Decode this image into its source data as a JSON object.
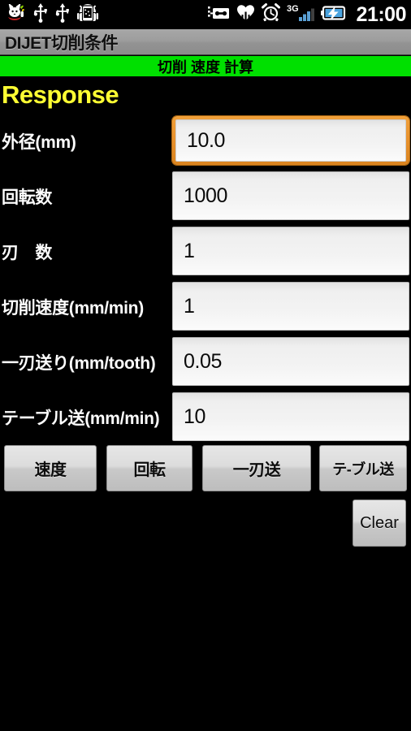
{
  "statusbar": {
    "clock": "21:00",
    "left_icons": [
      {
        "name": "cat-mascot-icon"
      },
      {
        "name": "usb-icon"
      },
      {
        "name": "usb-icon"
      },
      {
        "name": "android-debug-icon"
      }
    ],
    "right_icons": [
      {
        "name": "notification-tag-icon"
      },
      {
        "name": "heart-icon"
      },
      {
        "name": "alarm-clock-icon"
      },
      {
        "name": "signal-3g-icon",
        "label": "3G"
      },
      {
        "name": "battery-charging-icon"
      }
    ]
  },
  "titlebar": {
    "app_title": "DIJET切削条件"
  },
  "banner": {
    "text": "切削 速度 計算",
    "background": "#00e000"
  },
  "main": {
    "heading": "Response",
    "heading_color": "#ffff33",
    "fields": [
      {
        "label": "外径(mm)",
        "value": "10.0",
        "focused": true
      },
      {
        "label": "回転数",
        "value": "1000",
        "focused": false
      },
      {
        "label": "刃　数",
        "value": "1",
        "focused": false
      },
      {
        "label": "切削速度(mm/min)",
        "value": "1",
        "focused": false
      },
      {
        "label": "一刃送り(mm/tooth)",
        "value": "0.05",
        "focused": false
      },
      {
        "label": "テーブル送(mm/min)",
        "value": "10",
        "focused": false
      }
    ]
  },
  "buttons": {
    "sokudo": "速度",
    "kaiten": "回転",
    "hitoha": "一刃送",
    "table": "テ-ブル送",
    "clear": "Clear"
  }
}
